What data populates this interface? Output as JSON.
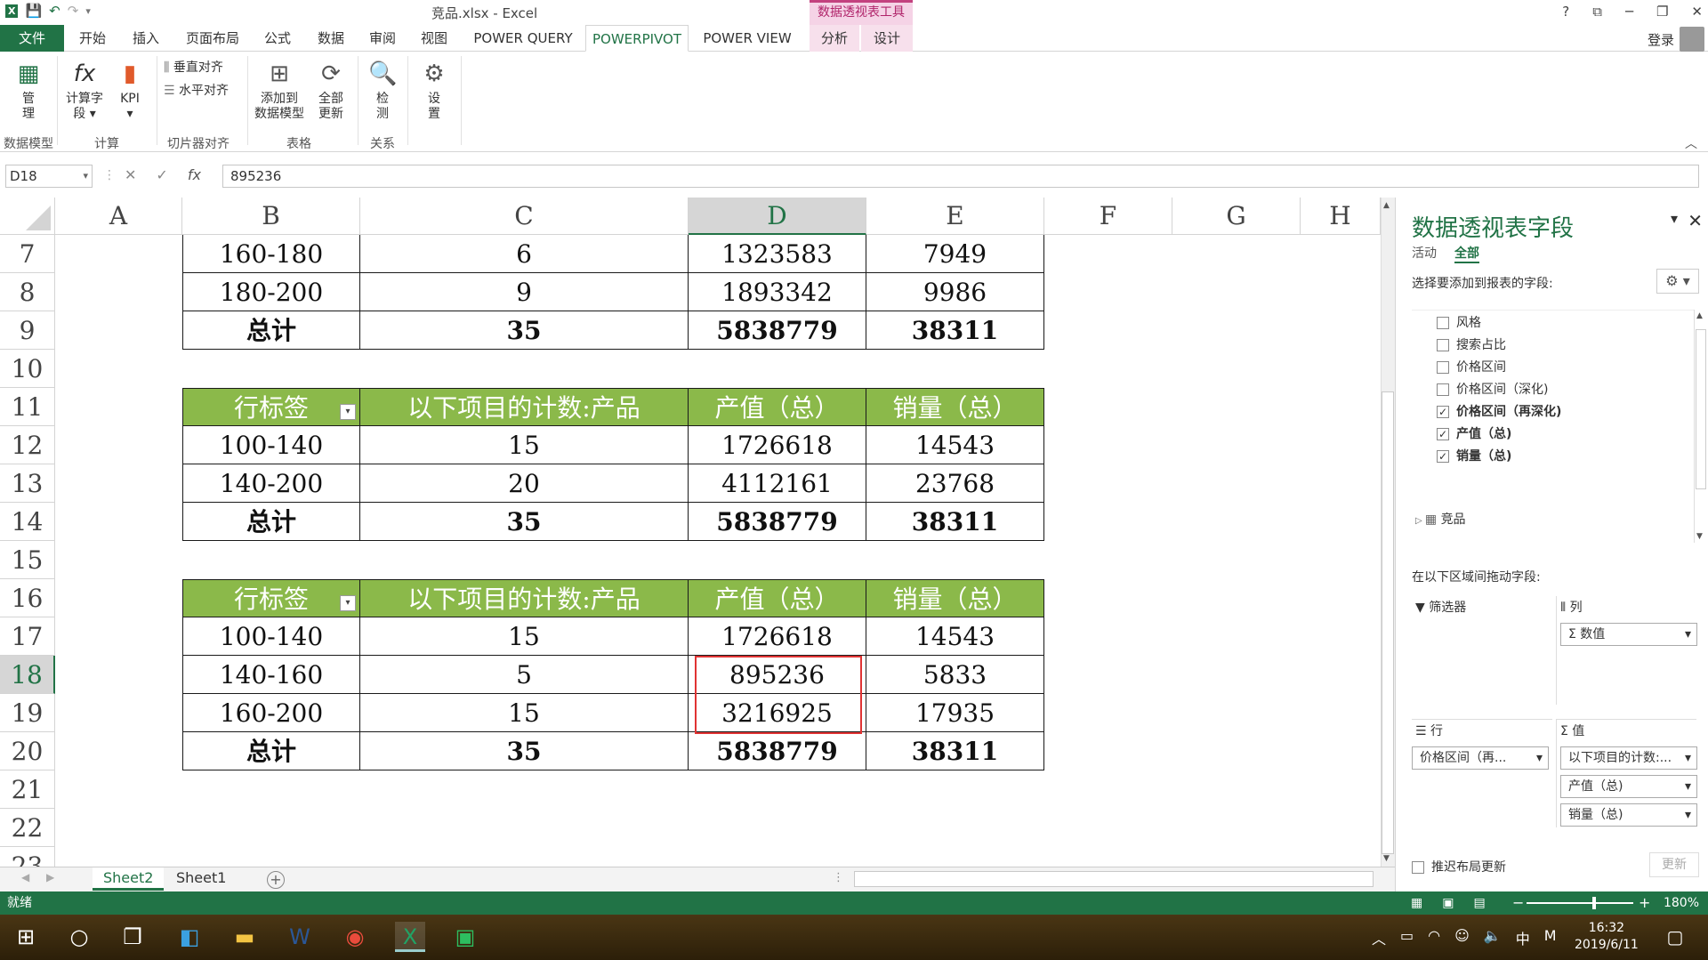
{
  "titlebar": {
    "window_title": "竞品.xlsx - Excel",
    "context_tool": "数据透视表工具",
    "help": "?",
    "restore_icon": "⧉",
    "minimize_icon": "─",
    "maximize_icon": "❐",
    "close_icon": "✕"
  },
  "tabs": {
    "file": "文件",
    "home": "开始",
    "insert": "插入",
    "layout": "页面布局",
    "formulas": "公式",
    "data": "数据",
    "review": "审阅",
    "view": "视图",
    "powerquery": "POWER QUERY",
    "powerpivot": "POWERPIVOT",
    "powerview": "POWER VIEW",
    "analyze": "分析",
    "design": "设计",
    "login": "登录"
  },
  "ribbon": {
    "manage": "管\n理",
    "calc_field": "计算字\n段 ▾",
    "kpi": "KPI\n▾",
    "v_align": "垂直对齐",
    "h_align": "水平对齐",
    "add_model": "添加到\n数据模型",
    "refresh_all": "全部\n更新",
    "detect": "检\n测",
    "settings": "设\n置",
    "grp_model": "数据模型",
    "grp_calc": "计算",
    "grp_slicer": "切片器对齐",
    "grp_table": "表格",
    "grp_rel": "关系"
  },
  "formula_bar": {
    "name_box": "D18",
    "cancel": "✕",
    "enter": "✓",
    "fx": "fx",
    "value": "895236"
  },
  "columns": [
    "A",
    "B",
    "C",
    "D",
    "E",
    "F",
    "G",
    "H"
  ],
  "rows": [
    "7",
    "8",
    "9",
    "10",
    "11",
    "12",
    "13",
    "14",
    "15",
    "16",
    "17",
    "18",
    "19",
    "20",
    "21",
    "22",
    "23"
  ],
  "table1": [
    [
      "160-180",
      "6",
      "1323583",
      "7949"
    ],
    [
      "180-200",
      "9",
      "1893342",
      "9986"
    ],
    [
      "总计",
      "35",
      "5838779",
      "38311"
    ]
  ],
  "table2": {
    "headers": [
      "行标签",
      "以下项目的计数:产品",
      "产值（总）",
      "销量（总）"
    ],
    "rows": [
      [
        "100-140",
        "15",
        "1726618",
        "14543"
      ],
      [
        "140-200",
        "20",
        "4112161",
        "23768"
      ],
      [
        "总计",
        "35",
        "5838779",
        "38311"
      ]
    ]
  },
  "table3": {
    "headers": [
      "行标签",
      "以下项目的计数:产品",
      "产值（总）",
      "销量（总）"
    ],
    "rows": [
      [
        "100-140",
        "15",
        "1726618",
        "14543"
      ],
      [
        "140-160",
        "5",
        "895236",
        "5833"
      ],
      [
        "160-200",
        "15",
        "3216925",
        "17935"
      ],
      [
        "总计",
        "35",
        "5838779",
        "38311"
      ]
    ]
  },
  "sheets": {
    "sheet2": "Sheet2",
    "sheet1": "Sheet1",
    "add": "+"
  },
  "status": {
    "ready": "就绪",
    "zoom": "180%",
    "minus": "−",
    "plus": "+"
  },
  "pane": {
    "title": "数据透视表字段",
    "tab_active": "活动",
    "tab_all": "全部",
    "choose": "选择要添加到报表的字段:",
    "fields": [
      {
        "label": "风格",
        "checked": ""
      },
      {
        "label": "搜索占比",
        "checked": ""
      },
      {
        "label": "价格区间",
        "checked": ""
      },
      {
        "label": "价格区间（深化)",
        "checked": ""
      },
      {
        "label": "价格区间（再深化)",
        "checked": "✓"
      },
      {
        "label": "产值（总)",
        "checked": "✓"
      },
      {
        "label": "销量（总)",
        "checked": "✓"
      }
    ],
    "table_node": "竞品",
    "drag": "在以下区域间拖动字段:",
    "filter": "筛选器",
    "columns": "列",
    "col_value": "Σ 数值",
    "rows": "行",
    "row_value": "价格区间（再...",
    "values": "Σ 值",
    "val1": "以下项目的计数:...",
    "val2": "产值（总)",
    "val3": "销量（总)",
    "defer": "推迟布局更新",
    "update": "更新"
  },
  "taskbar": {
    "time": "16:32",
    "date": "2019/6/11",
    "ime": "中",
    "ime2": "M"
  }
}
